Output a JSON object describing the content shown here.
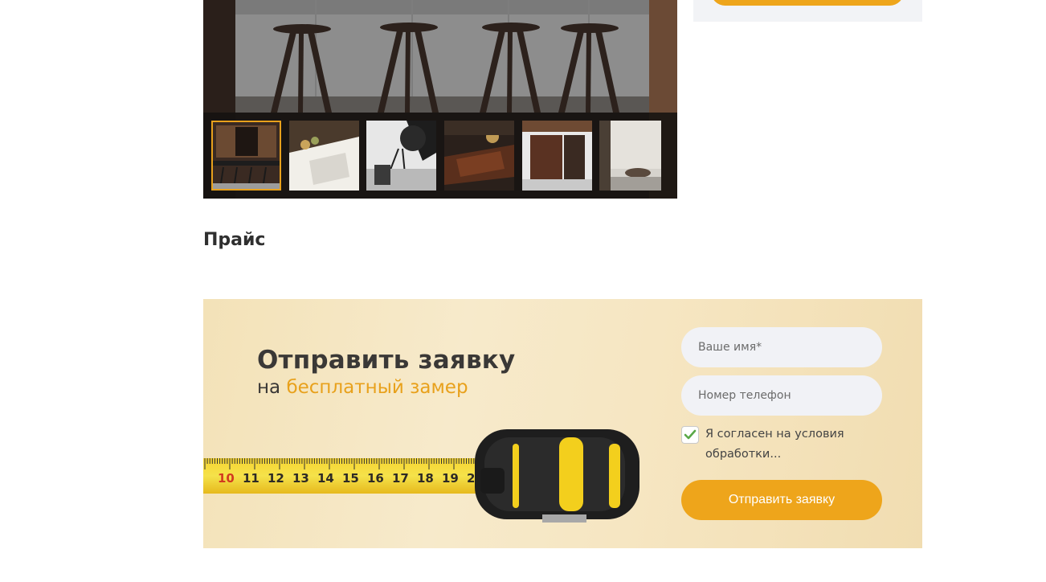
{
  "gallery": {
    "thumbnails": [
      {
        "alt": "bar-kitchen",
        "active": true
      },
      {
        "alt": "sink-counter",
        "active": false
      },
      {
        "alt": "studio-lights",
        "active": false
      },
      {
        "alt": "wood-table",
        "active": false
      },
      {
        "alt": "dark-kitchen",
        "active": false
      },
      {
        "alt": "interior-room",
        "active": false
      }
    ]
  },
  "price": {
    "title": "Прайс"
  },
  "request": {
    "title": "Отправить заявку",
    "subtitle_prefix": "на",
    "subtitle_accent": "бесплатный замер",
    "name_placeholder": "Ваше имя*",
    "phone_placeholder": "Номер телефон",
    "agree_text": "Я согласен на условия обработки...",
    "agree_checked": true,
    "submit_label": "Отправить заявку",
    "tape_numbers": [
      "10",
      "11",
      "12",
      "13",
      "14",
      "15",
      "16",
      "17",
      "18",
      "19",
      "2"
    ]
  },
  "colors": {
    "accent": "#eea51b",
    "field_bg": "#f1f2f6",
    "text_dark": "#3a3836"
  }
}
